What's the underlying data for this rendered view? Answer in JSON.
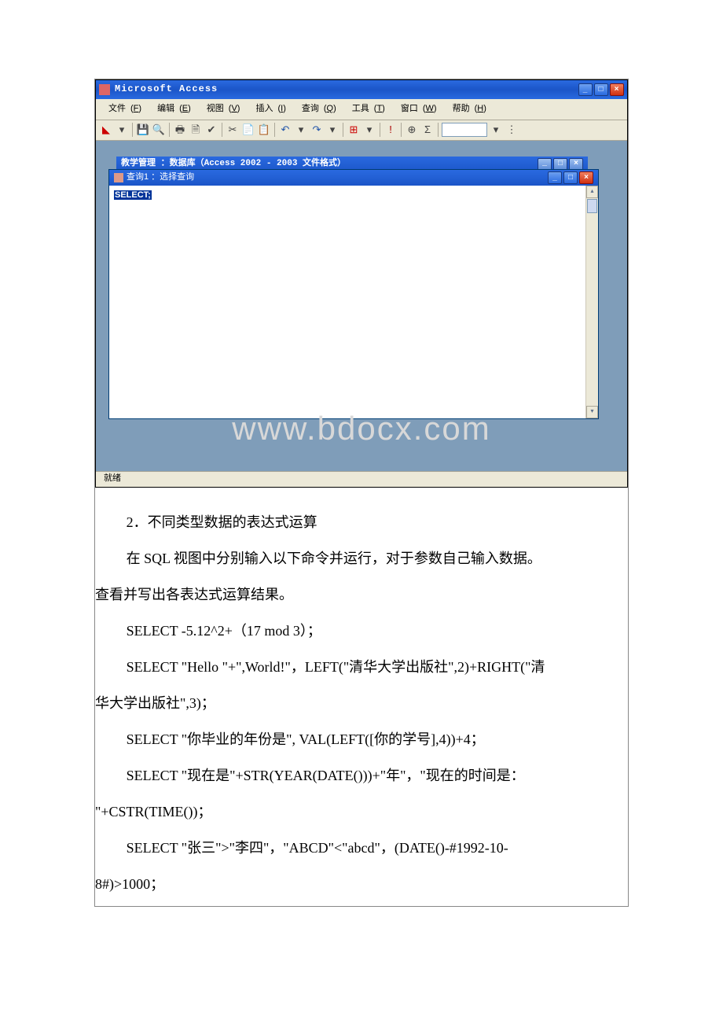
{
  "app": {
    "title": "Microsoft Access",
    "menus": [
      {
        "label": "文件",
        "hotkey": "F"
      },
      {
        "label": "编辑",
        "hotkey": "E"
      },
      {
        "label": "视图",
        "hotkey": "V"
      },
      {
        "label": "插入",
        "hotkey": "I"
      },
      {
        "label": "查询",
        "hotkey": "Q"
      },
      {
        "label": "工具",
        "hotkey": "T"
      },
      {
        "label": "窗口",
        "hotkey": "W"
      },
      {
        "label": "帮助",
        "hotkey": "H"
      }
    ],
    "window_controls": {
      "min": "_",
      "max": "□",
      "close": "×"
    },
    "bg_window_title": "教学管理 ：数据库（Access 2002 - 2003 文件格式）",
    "inner_window_title": "查询1 ：选择查询",
    "editor_text": "SELECT;",
    "status": "就绪",
    "watermark": "www.bdocx.com"
  },
  "doc": {
    "para1": "2．不同类型数据的表达式运算",
    "para2_a": "在 SQL 视图中分别输入以下命令并运行，对于参数自己输入数据。",
    "para2_b": "查看并写出各表达式运算结果。",
    "sql1": "SELECT -5.12^2+（17 mod 3）；",
    "sql2_a": "SELECT \"Hello \"+\",World!\"，LEFT(\"清华大学出版社\",2)+RIGHT(\"清",
    "sql2_b": "华大学出版社\",3)；",
    "sql3": "SELECT \"你毕业的年份是\", VAL(LEFT([你的学号],4))+4；",
    "sql4_a": "SELECT \"现在是\"+STR(YEAR(DATE()))+\"年\"，\"现在的时间是：",
    "sql4_b": "\"+CSTR(TIME())；",
    "sql5_a": "SELECT \"张三\">\"李四\"，\"ABCD\"<\"abcd\"，(DATE()-#1992-10-",
    "sql5_b": "8#)>1000；"
  }
}
